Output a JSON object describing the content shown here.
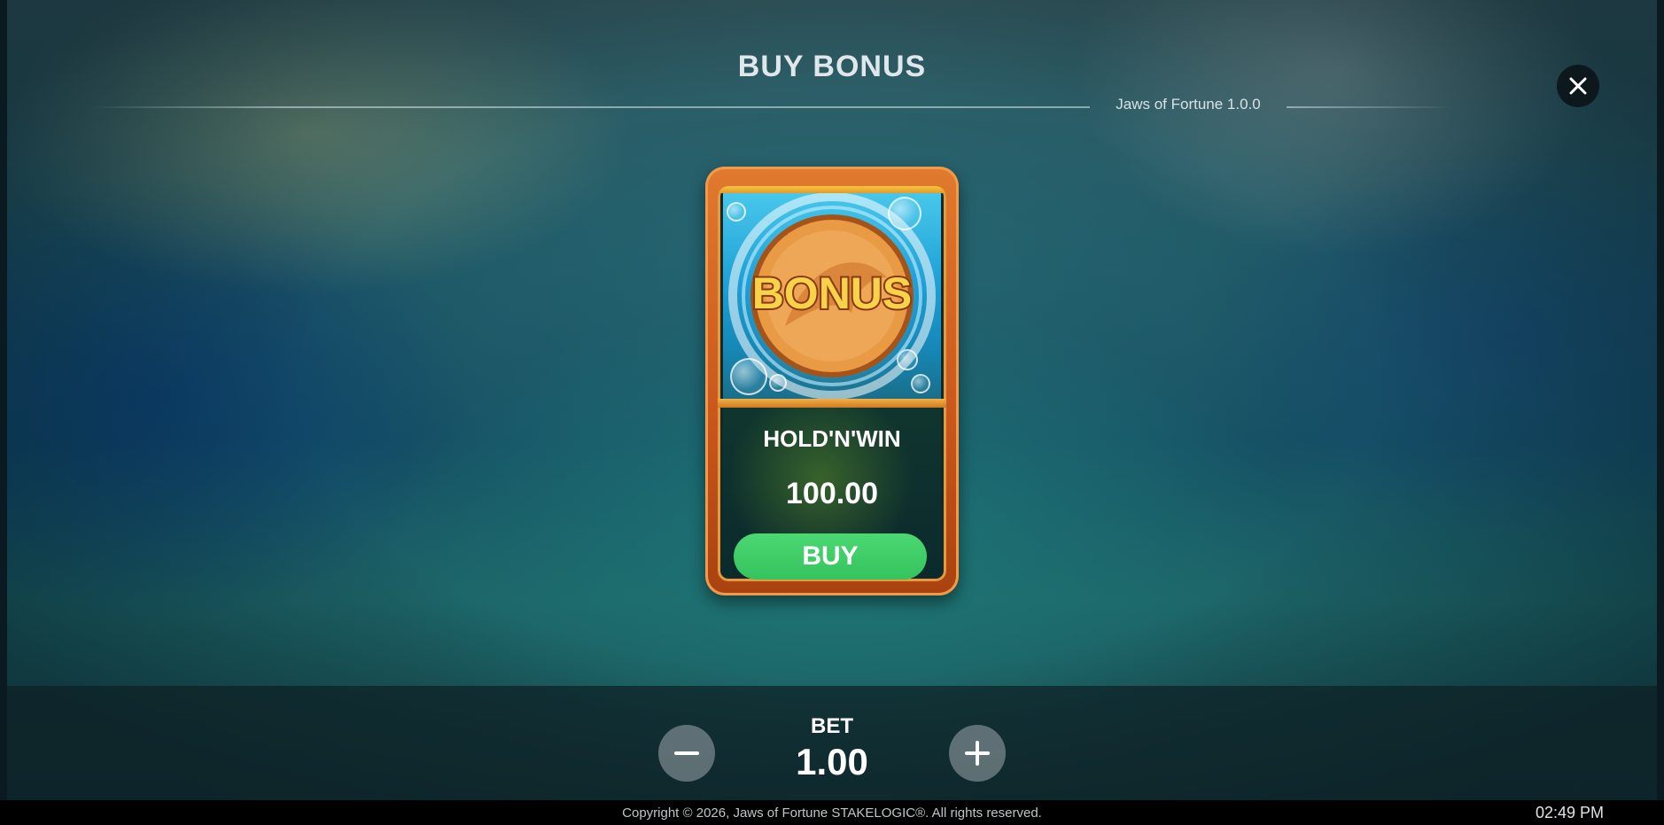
{
  "header": {
    "title": "BUY BONUS",
    "version": "Jaws of Fortune 1.0.0",
    "close_icon": "close-icon"
  },
  "bonus_card": {
    "art_text": "BONUS",
    "feature_name": "HOLD'N'WIN",
    "price": "100.00",
    "buy_label": "BUY",
    "colors": {
      "frame": "#c8561c",
      "buy_button": "#3ccb64",
      "coin": "#e89a3a"
    }
  },
  "bet": {
    "label": "BET",
    "value": "1.00",
    "decrease_icon": "minus-icon",
    "increase_icon": "plus-icon"
  },
  "footer": {
    "copyright": "Copyright © 2026, Jaws of Fortune STAKELOGIC®. All rights reserved.",
    "time": "02:49 PM"
  }
}
